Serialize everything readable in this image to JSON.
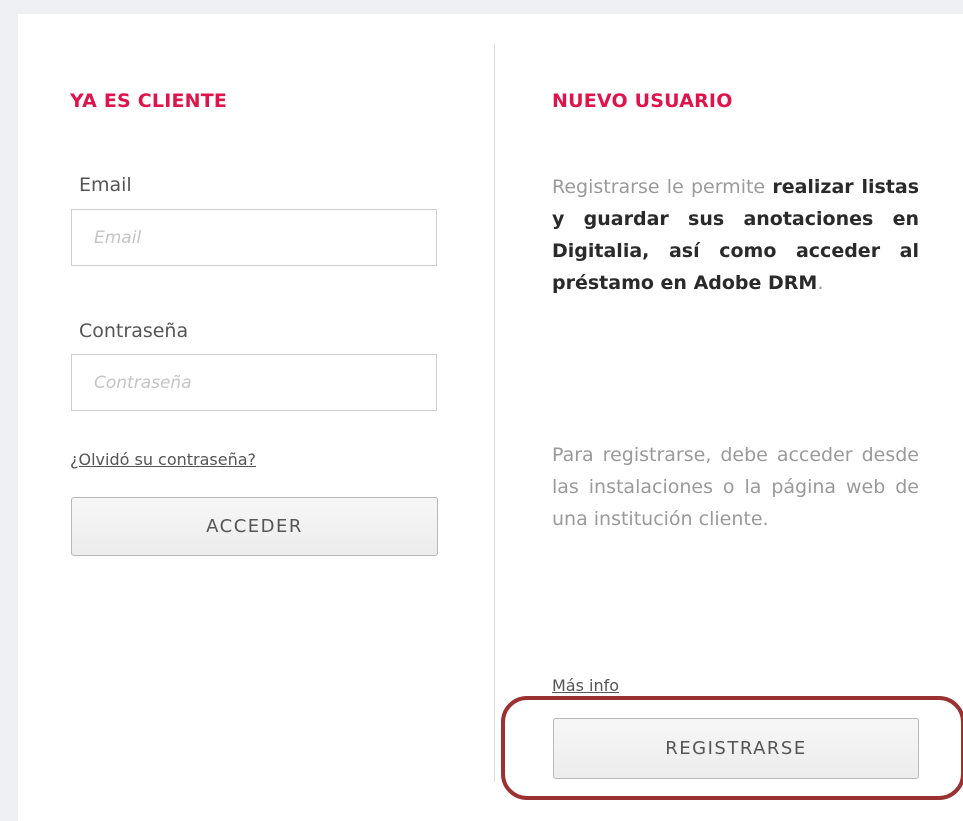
{
  "login": {
    "heading": "YA ES CLIENTE",
    "email_label": "Email",
    "email_placeholder": "Email",
    "email_value": "",
    "password_label": "Contraseña",
    "password_placeholder": "Contraseña",
    "password_value": "",
    "forgot_link": "¿Olvidó su contraseña?",
    "submit_label": "ACCEDER"
  },
  "register": {
    "heading": "NUEVO USUARIO",
    "intro_text_1": "Registrarse le permite ",
    "intro_bold_1": "realizar listas y guardar sus anotaciones en Digitalia, así como acceder al préstamo en Adobe DRM",
    "intro_text_2": ".",
    "info_text": "Para registrarse, debe acceder desde las instalaciones o la página web de una institución cliente.",
    "more_info_link": "Más info",
    "register_label": "REGISTRARSE"
  },
  "colors": {
    "accent": "#e0144c",
    "highlight_ring": "#9a3232",
    "background": "#eef0f3"
  }
}
